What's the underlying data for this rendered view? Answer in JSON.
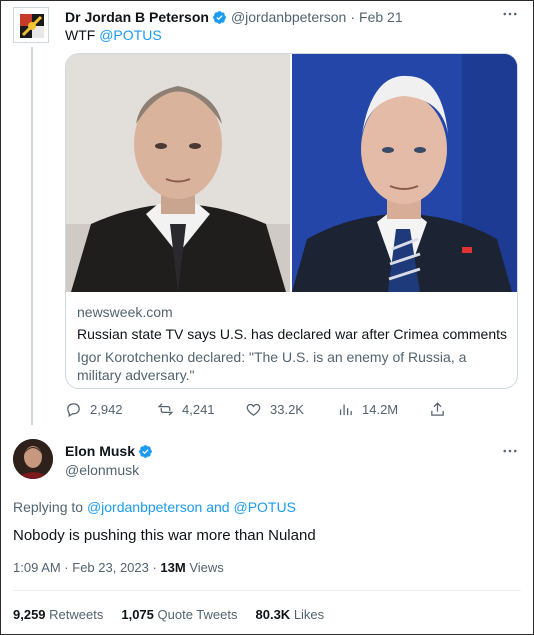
{
  "parent": {
    "display_name": "Dr Jordan B Peterson",
    "handle": "@jordanbpeterson",
    "separator": "·",
    "time": "Feb 21",
    "text_prefix": "WTF ",
    "text_mention": "@POTUS",
    "card": {
      "domain": "newsweek.com",
      "title": "Russian state TV says U.S. has declared war after Crimea comments",
      "description": "Igor Korotchenko declared: \"The U.S. is an enemy of Russia, a military adversary.\""
    },
    "actions": {
      "replies": "2,942",
      "retweets": "4,241",
      "likes": "33.2K",
      "views": "14.2M"
    }
  },
  "main": {
    "display_name": "Elon Musk",
    "handle": "@elonmusk",
    "replying_prefix": "Replying to ",
    "replying_user1": "@jordanbpeterson",
    "replying_and": " and ",
    "replying_user2": "@POTUS",
    "text": "Nobody is pushing this war more than Nuland",
    "timestamp": "1:09 AM · Feb 23, 2023 · ",
    "views_count": "13M",
    "views_label": " Views",
    "stats": {
      "retweets_count": "9,259",
      "retweets_label": " Retweets",
      "quotes_count": "1,075",
      "quotes_label": " Quote Tweets",
      "likes_count": "80.3K",
      "likes_label": " Likes"
    }
  },
  "icons": {
    "more": "more-horizontal-icon",
    "verified": "verified-badge-icon",
    "reply": "reply-icon",
    "retweet": "retweet-icon",
    "like": "heart-icon",
    "views": "views-icon",
    "share": "share-icon"
  },
  "colors": {
    "accent": "#1d9bf0",
    "secondary_text": "#536471",
    "primary_text": "#0f1419",
    "border": "#cfd9de"
  }
}
